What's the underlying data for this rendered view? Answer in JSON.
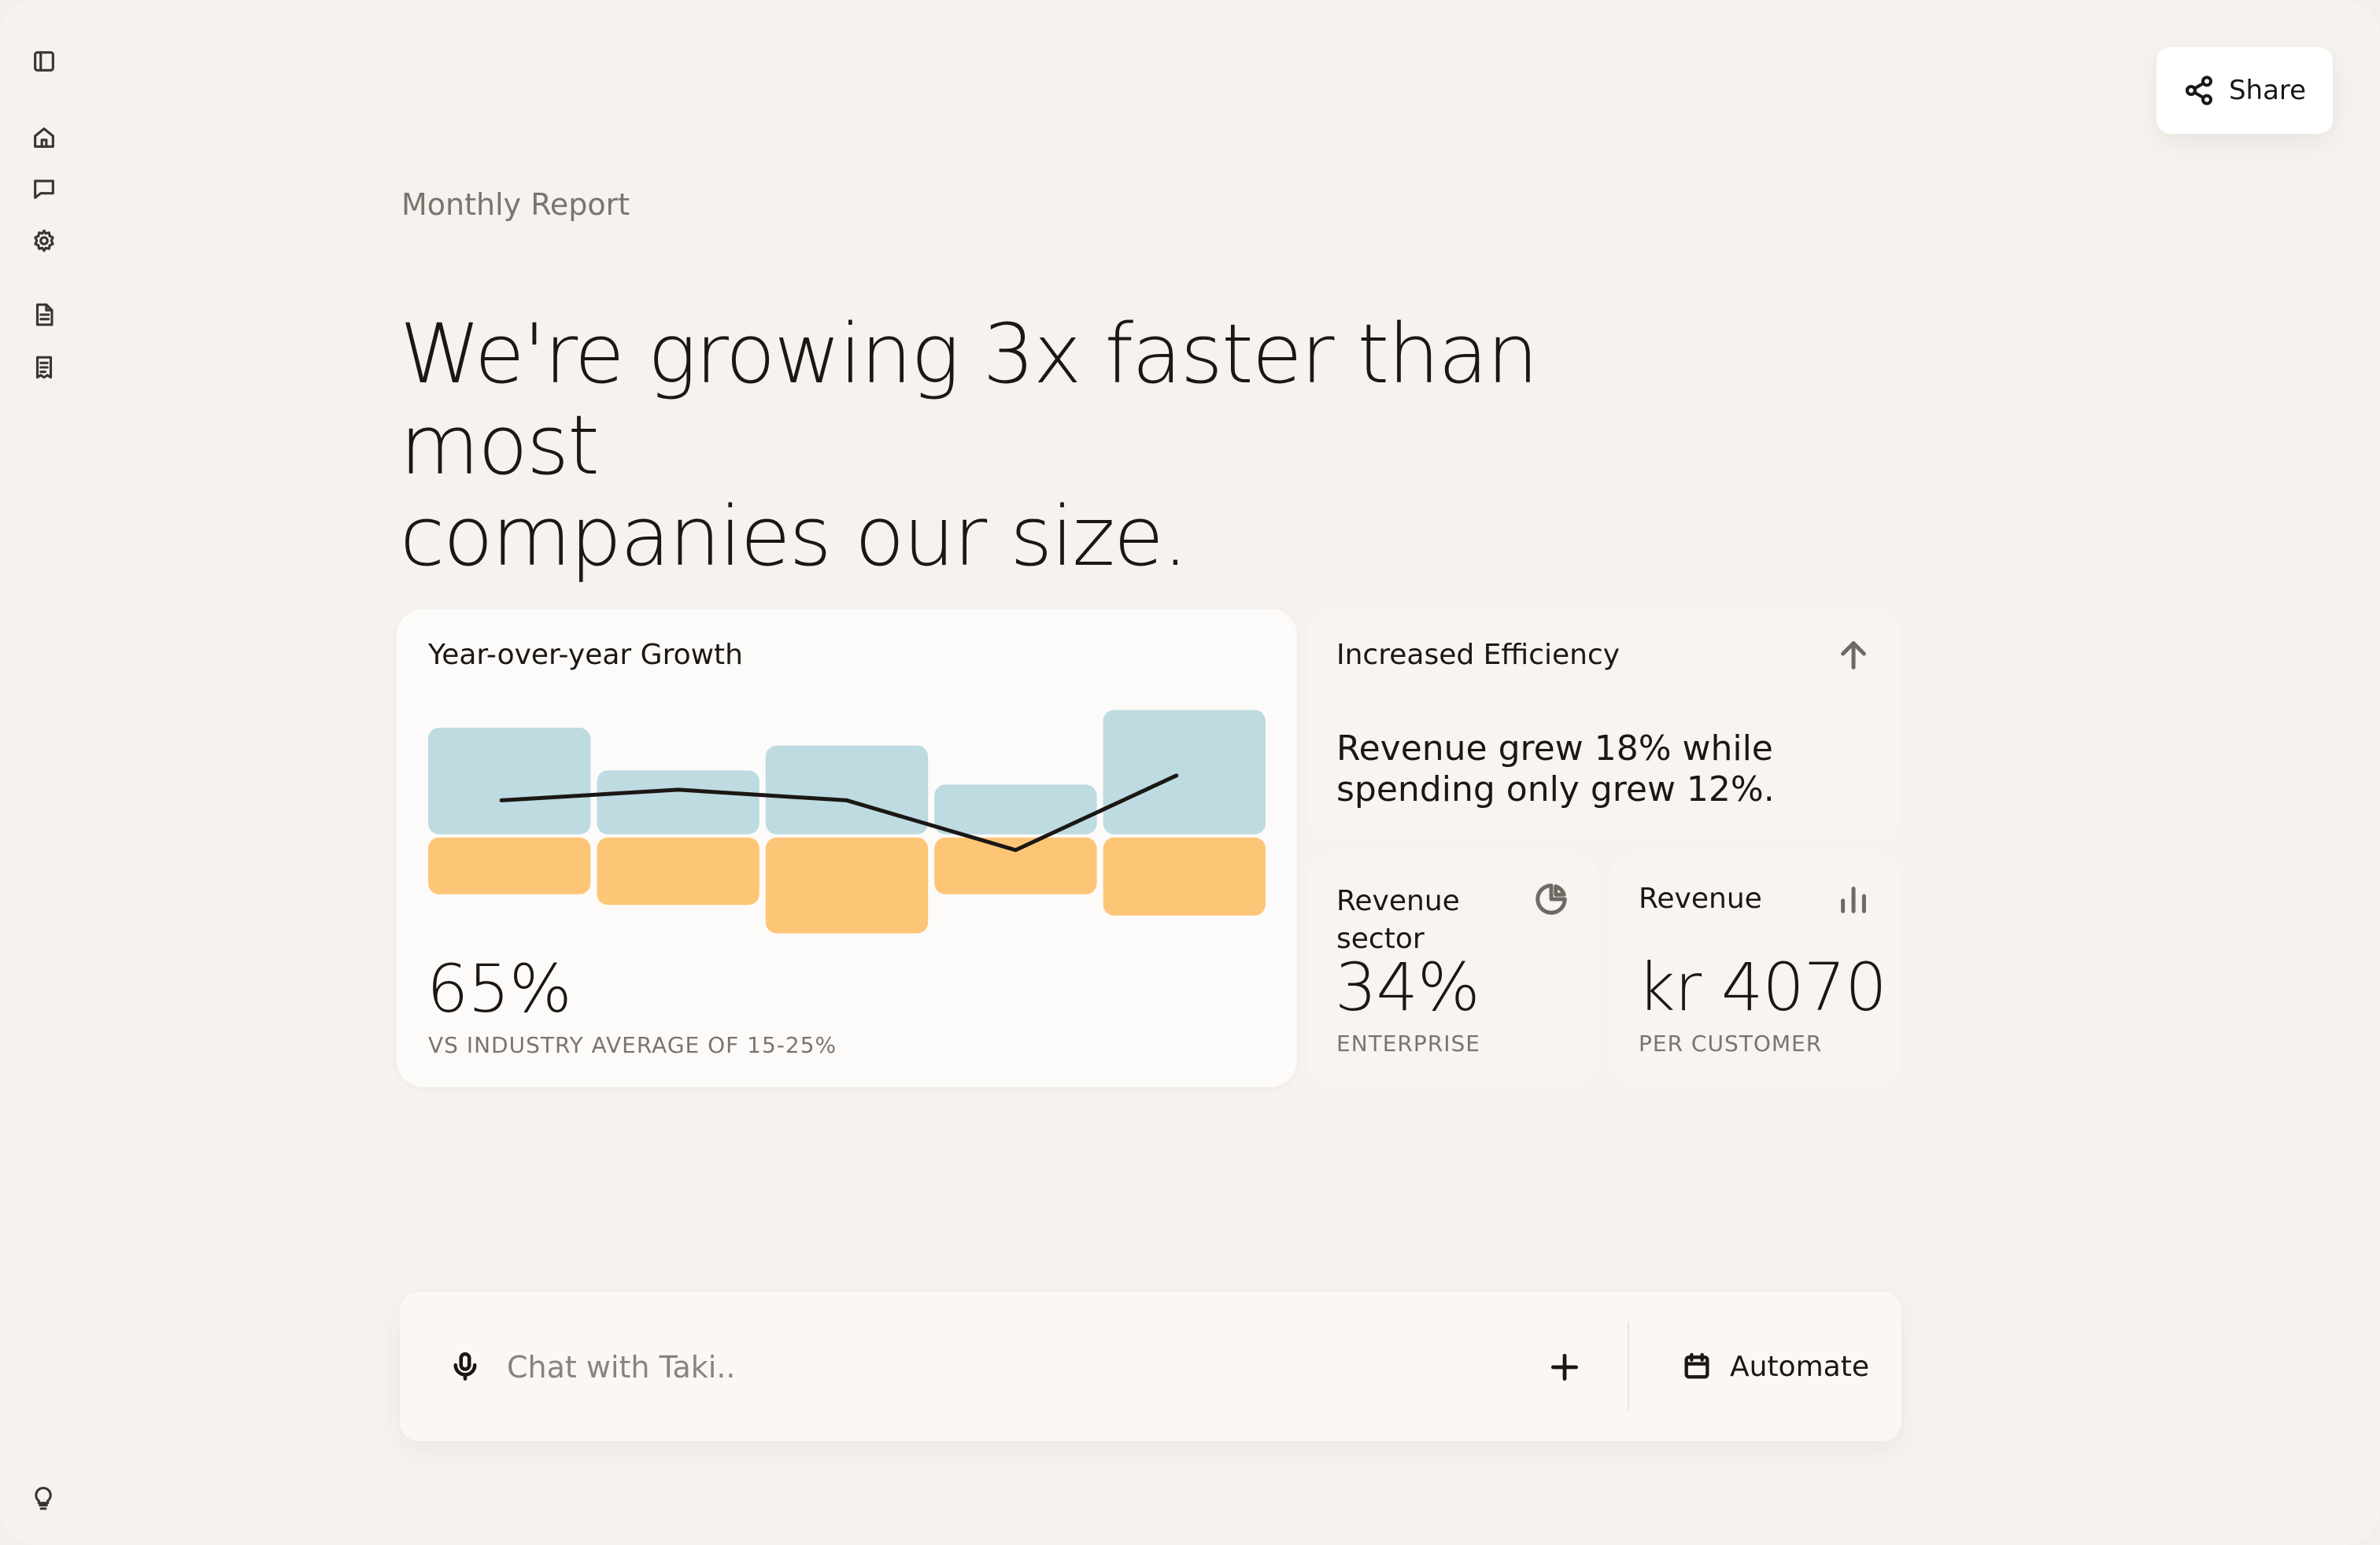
{
  "sidebar": {
    "icons": [
      "sidebar-toggle-icon",
      "home-icon",
      "chat-icon",
      "settings-icon",
      "document-icon",
      "receipt-icon",
      "lightbulb-icon"
    ]
  },
  "header": {
    "share_label": "Share",
    "share_icon": "share-icon"
  },
  "report": {
    "label": "Monthly Report",
    "headline_line1": "We're growing 3x faster than most",
    "headline_line2": "companies our size."
  },
  "growth_card": {
    "title": "Year-over-year Growth",
    "value": "65%",
    "caption": "VS INDUSTRY AVERAGE OF 15-25%"
  },
  "efficiency_card": {
    "title": "Increased Efficiency",
    "icon": "arrow-up-icon",
    "text": "Revenue grew 18% while spending only grew 12%."
  },
  "sector_card": {
    "title": "Revenue sector",
    "icon": "pie-chart-icon",
    "value": "34%",
    "caption": "ENTERPRISE"
  },
  "revenue_card": {
    "title": "Revenue",
    "icon": "bar-chart-icon",
    "value": "kr 4070",
    "caption": "PER CUSTOMER"
  },
  "chat": {
    "placeholder": "Chat with Taki..",
    "automate_label": "Automate"
  },
  "colors": {
    "background": "#f6f2ee",
    "blue_bar": "#bddbe1",
    "orange_bar": "#fdc677",
    "line": "#1b1714"
  },
  "chart_data": {
    "type": "bar",
    "categories": [
      "",
      "",
      "",
      "",
      ""
    ],
    "series": [
      {
        "values": [
          3.0,
          1.8,
          2.5,
          1.4,
          3.5
        ]
      },
      {
        "values": [
          -1.6,
          -1.9,
          -2.7,
          -1.6,
          -2.2
        ]
      }
    ],
    "line": [
      1.0,
      1.3,
      1.0,
      -0.4,
      1.7
    ],
    "ylim": [
      -3,
      4
    ],
    "grid": false
  }
}
